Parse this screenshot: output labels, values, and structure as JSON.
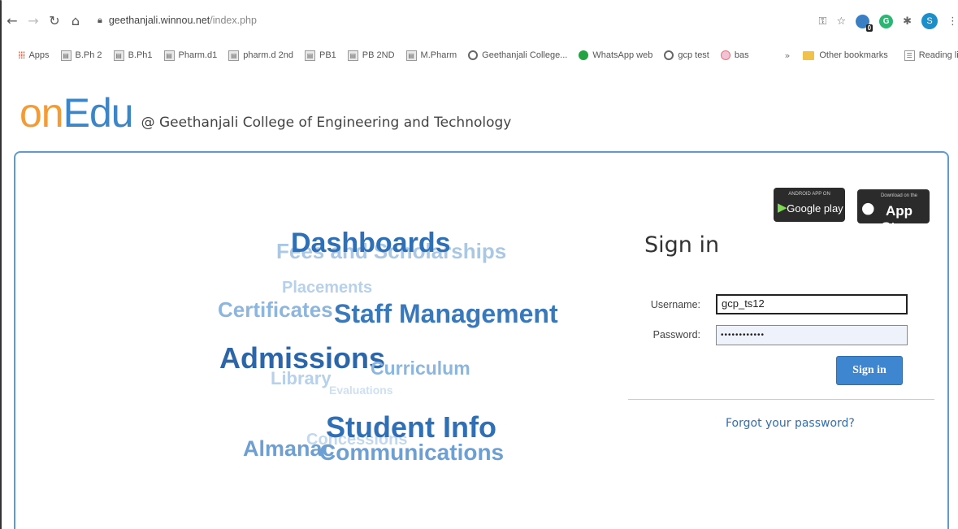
{
  "browser": {
    "url_host": "geethanjali.winnou.net",
    "url_path": "/index.php",
    "profile_initial": "S",
    "extension_badge": "0",
    "bookmarks": [
      {
        "label": "Apps",
        "icon": "apps-grid-icon"
      },
      {
        "label": "B.Ph 2",
        "icon": "page-icon"
      },
      {
        "label": "B.Ph1",
        "icon": "page-icon"
      },
      {
        "label": "Pharm.d1",
        "icon": "page-icon"
      },
      {
        "label": "pharm.d 2nd",
        "icon": "page-icon"
      },
      {
        "label": "PB1",
        "icon": "page-icon"
      },
      {
        "label": "PB 2ND",
        "icon": "page-icon"
      },
      {
        "label": "M.Pharm",
        "icon": "page-icon"
      },
      {
        "label": "Geethanjali College...",
        "icon": "college-icon"
      },
      {
        "label": "WhatsApp web",
        "icon": "whatsapp-icon"
      },
      {
        "label": "gcp test",
        "icon": "college-icon"
      },
      {
        "label": "bas",
        "icon": "site-icon"
      }
    ],
    "more": "»",
    "other_bookmarks": "Other bookmarks",
    "reading_list": "Reading list"
  },
  "header": {
    "logo_on": "on",
    "logo_edu": "Edu",
    "tagline": "@ Geethanjali College of Engineering and Technology"
  },
  "stores": {
    "google_small": "ANDROID APP ON",
    "google_big": "Google play",
    "apple_small": "Download on the",
    "apple_big": "App Store"
  },
  "word_cloud": {
    "fees": "Fees and Scholarships",
    "dashboards": "Dashboards",
    "placements": "Placements",
    "certificates": "Certificates",
    "staff": "Staff Management",
    "admissions": "Admissions",
    "library": "Library",
    "curriculum": "Curriculum",
    "evaluations": "Evaluations",
    "student_info": "Student Info",
    "concessions": "Concessions",
    "almanac": "Almanac",
    "communications": "Communications"
  },
  "signin": {
    "title": "Sign in",
    "username_label": "Username:",
    "username_value": "gcp_ts12",
    "password_label": "Password:",
    "password_value": "••••••••••••",
    "button": "Sign in",
    "forgot": "Forgot your password?"
  },
  "colors": {
    "brand_orange": "#f39b34",
    "brand_blue": "#3b86c8",
    "button_blue": "#3f86d0"
  }
}
